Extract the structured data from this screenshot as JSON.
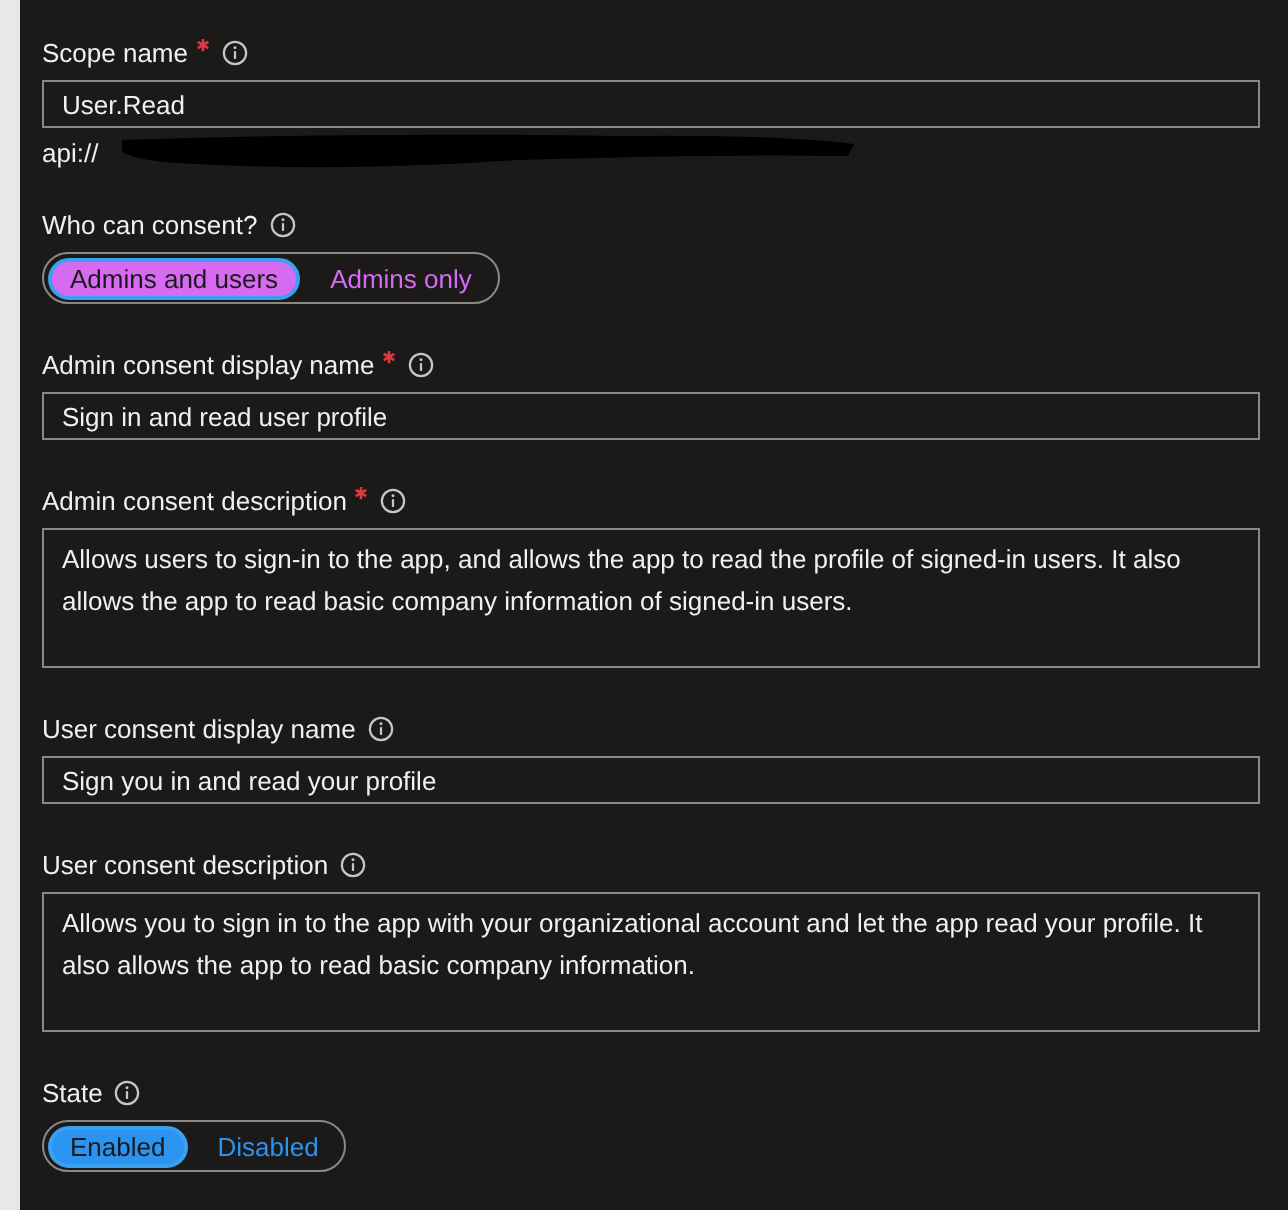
{
  "fields": [
    {
      "kind": "text",
      "label": "Scope name",
      "required": true,
      "value": "User.Read",
      "note": "api://",
      "redacted": true
    },
    {
      "kind": "choice",
      "label": "Who can consent?",
      "required": false,
      "color": "#d66bf2",
      "options": [
        {
          "label": "Admins and users",
          "selected": true
        },
        {
          "label": "Admins only",
          "selected": false
        }
      ]
    },
    {
      "kind": "text",
      "label": "Admin consent display name",
      "required": true,
      "value": "Sign in and read user profile"
    },
    {
      "kind": "textarea",
      "label": "Admin consent description",
      "required": true,
      "value": "Allows users to sign-in to the app, and allows the app to read the profile of signed-in users. It also allows the app to read basic company information of signed-in users."
    },
    {
      "kind": "text",
      "label": "User consent display name",
      "required": false,
      "value": "Sign you in and read your profile"
    },
    {
      "kind": "textarea",
      "label": "User consent description",
      "required": false,
      "value": "Allows you to sign in to the app with your organizational account and let the app read your profile. It also allows the app to read basic company information."
    },
    {
      "kind": "choice",
      "label": "State",
      "required": false,
      "color": "#2b93f0",
      "options": [
        {
          "label": "Enabled",
          "selected": true
        },
        {
          "label": "Disabled",
          "selected": false
        }
      ]
    }
  ]
}
